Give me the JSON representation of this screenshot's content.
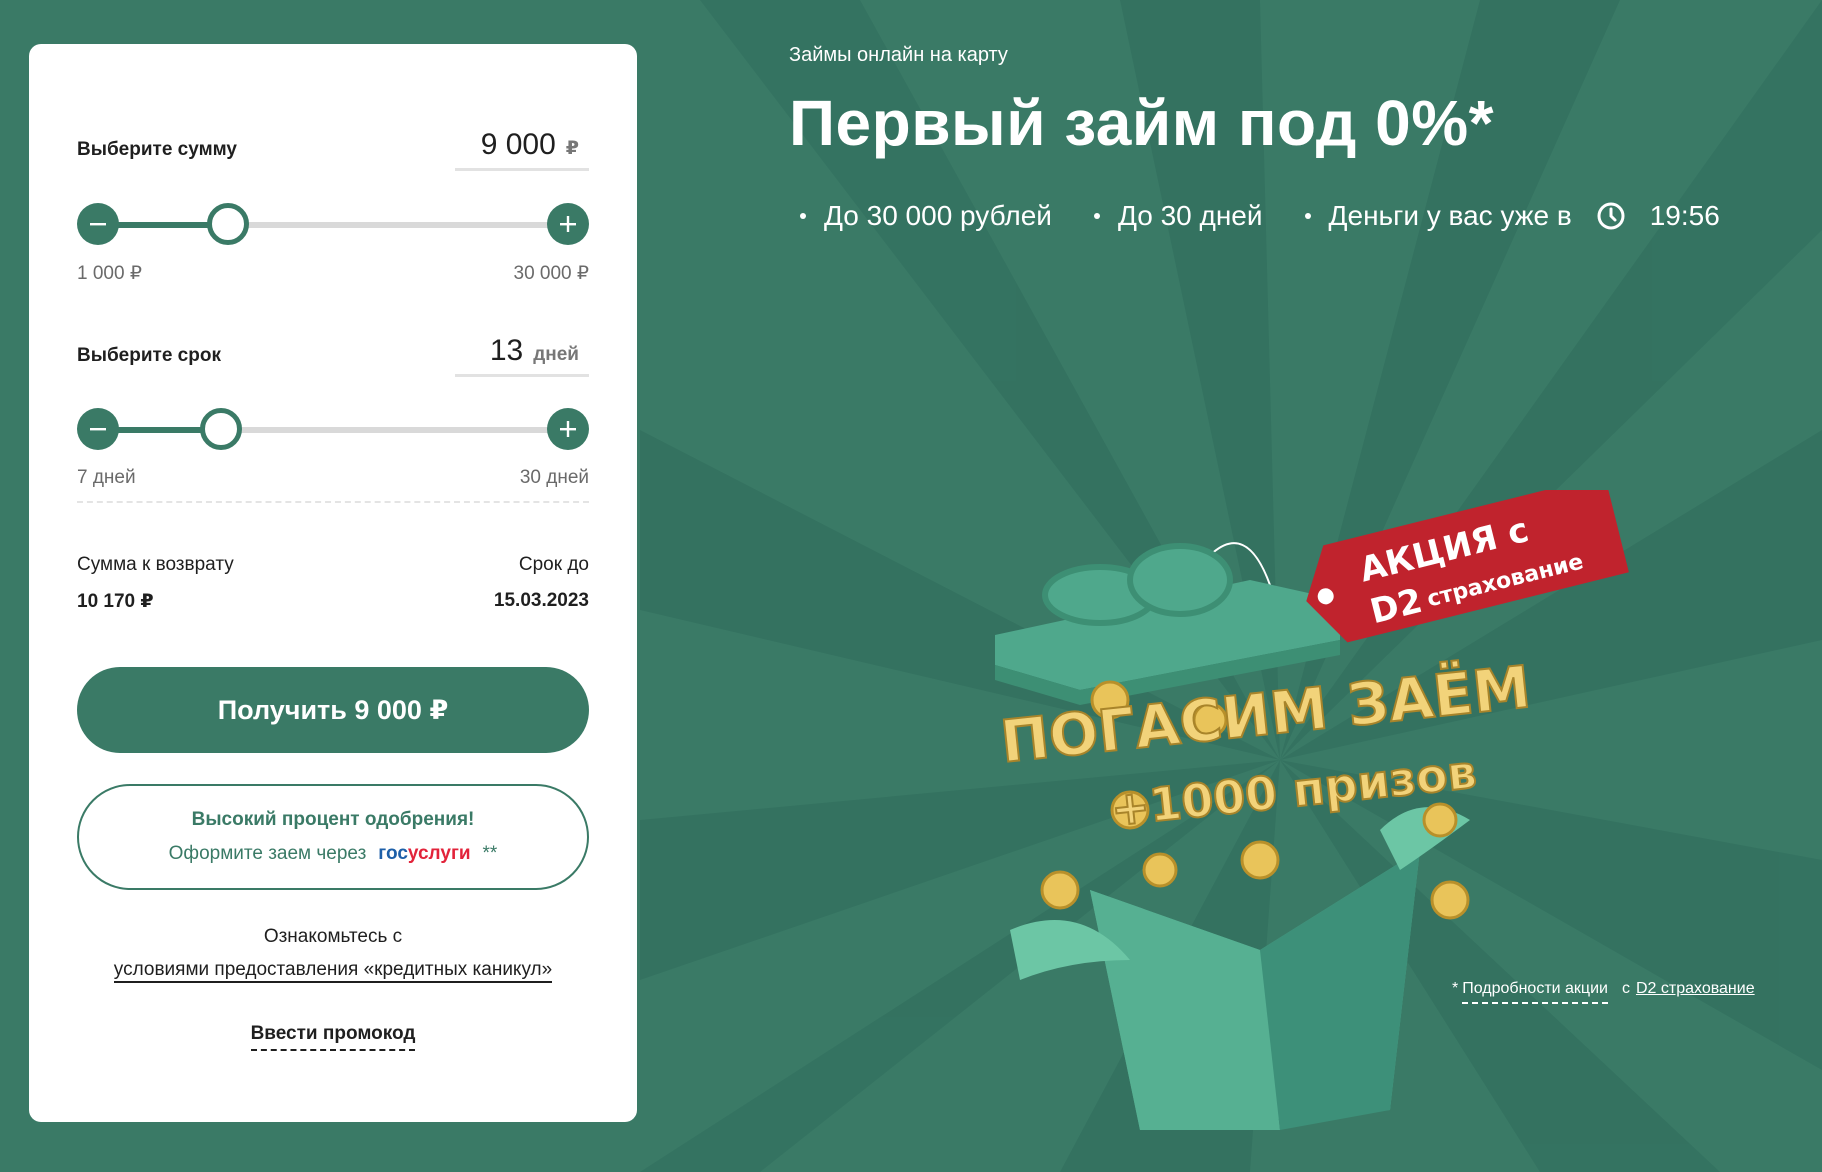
{
  "calculator": {
    "amount": {
      "label": "Выберите сумму",
      "value": "9 000",
      "unit": "₽",
      "min_label": "1 000 ₽",
      "max_label": "30 000 ₽",
      "min": 1000,
      "max": 30000,
      "current": 9000
    },
    "term": {
      "label": "Выберите срок",
      "value": "13",
      "unit": "дней",
      "min_label": "7 дней",
      "max_label": "30 дней",
      "min": 7,
      "max": 30,
      "current": 13
    },
    "decrease_icon": "minus-icon",
    "increase_icon": "plus-icon",
    "summary": {
      "return_label": "Сумма к возврату",
      "return_value": "10 170 ₽",
      "due_label": "Срок до",
      "due_value": "15.03.2023"
    },
    "cta_label": "Получить 9 000 ₽",
    "gosuslugi": {
      "title": "Высокий процент одобрения!",
      "text": "Оформите заем через",
      "logo_part1": "гос",
      "logo_part2": "услуги",
      "footnote": "**"
    },
    "terms_intro": "Ознакомьтесь с",
    "terms_link": "условиями предоставления «кредитных каникул»",
    "promo_code": "Ввести промокод"
  },
  "hero": {
    "eyebrow": "Займы онлайн на карту",
    "title": "Первый займ под 0%*",
    "bullets": [
      "До 30 000 рублей",
      "До 30 дней",
      "Деньги у вас уже в"
    ],
    "time": "19:56",
    "clock_icon": "clock-icon"
  },
  "promo": {
    "tag_line1": "АКЦИЯ с",
    "tag_brand": "D2",
    "tag_line2": "страхование",
    "headline1": "ПОГАСИМ ЗАЁМ",
    "headline2": "+1000 призов",
    "coin_symbol": "₽"
  },
  "footnote": {
    "star": "*",
    "link1": "Подробности акции",
    "prefix": "с",
    "link2": "D2 страхование"
  },
  "colors": {
    "brand_green": "#3a7a66",
    "background": "#3a7a66",
    "gift_green": "#4fa88c",
    "tag_red": "#c0232d",
    "gold": "#e9c45a"
  }
}
